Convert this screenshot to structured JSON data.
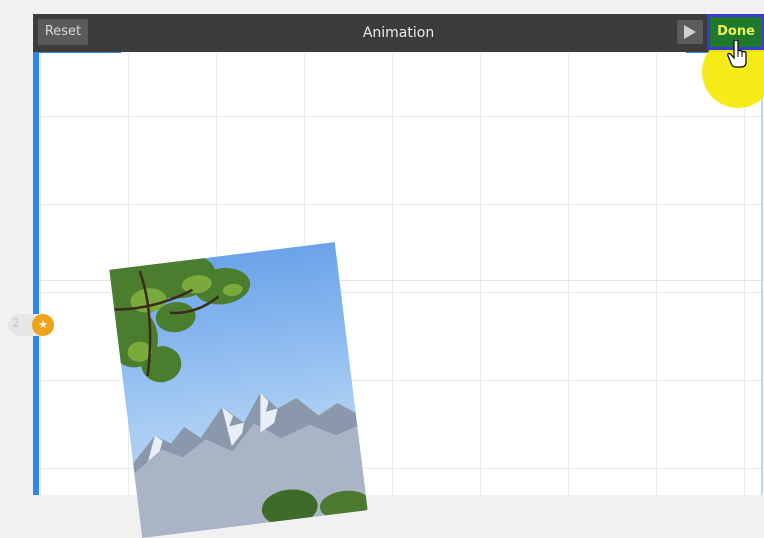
{
  "toolbar": {
    "reset_label": "Reset",
    "title": "Animation",
    "play_icon": "play-icon",
    "done_label": "Done"
  },
  "keyframe": {
    "number": "2",
    "icon": "star-icon",
    "color": "#f0a21a"
  },
  "colors": {
    "toolbar_bg": "#3c3c3c",
    "done_bg": "#1e7a2a",
    "done_text": "#e7f25a",
    "selection_blue": "#2f86e8",
    "click_highlight": "#f4ea0c"
  },
  "photo": {
    "subject": "tree branches over mountain range and blue sky"
  }
}
